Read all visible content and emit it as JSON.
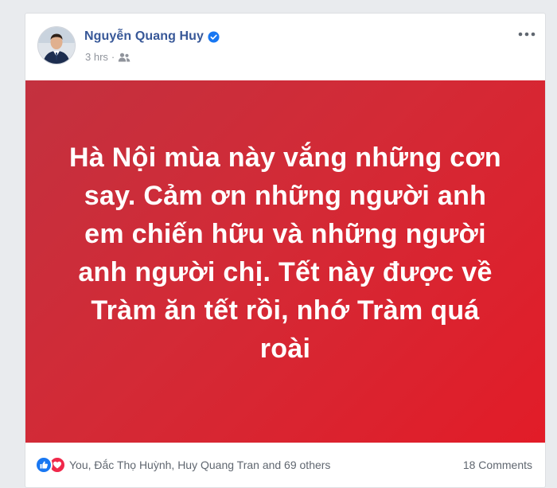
{
  "post": {
    "author": {
      "name": "Nguyễn Quang Huy",
      "verified": true,
      "avatar_icon": "profile-avatar"
    },
    "meta": {
      "time": "3 hrs",
      "separator": "·",
      "audience_icon": "friends-audience-icon"
    },
    "more_icon": "more-options-icon",
    "banner": {
      "text": "Hà Nội mùa này vắng những cơn say. Cảm ơn những người anh em chiến hữu và những người anh người chị. Tết này được về Tràm ăn tết rồi, nhớ Tràm quá roài",
      "background_start": "#c3313f",
      "background_end": "#e21c28",
      "text_color": "#ffffff"
    },
    "reactions": {
      "icons": [
        "like-icon",
        "love-icon"
      ],
      "summary": "You, Đắc Thọ Huỳnh, Huy Quang Tran and 69 others",
      "comments": "18 Comments"
    }
  },
  "colors": {
    "link_blue": "#385898",
    "meta_gray": "#90949c",
    "like_blue": "#1877f2",
    "love_red": "#f0284a"
  }
}
